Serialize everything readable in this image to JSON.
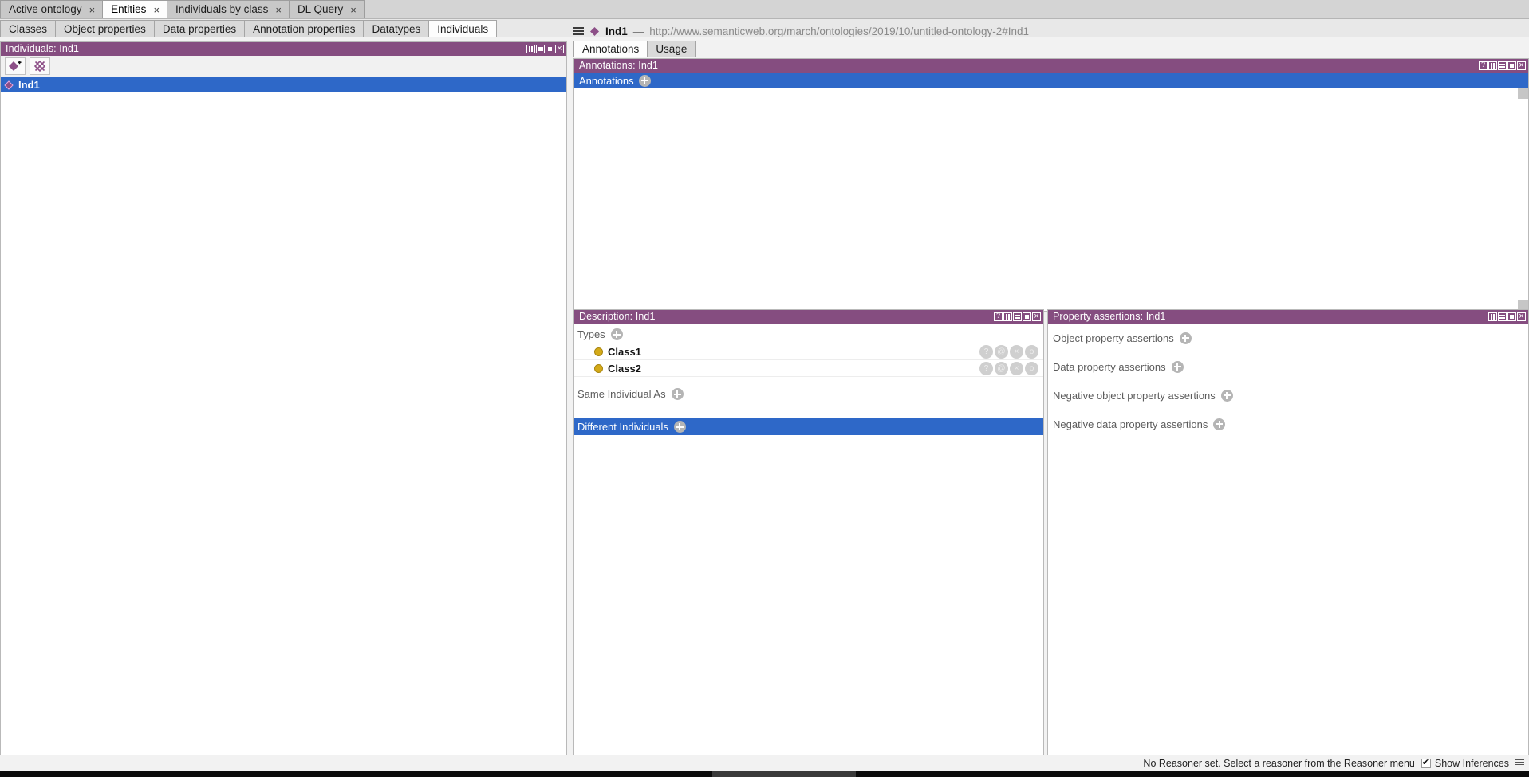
{
  "window": {
    "top_tabs": [
      {
        "label": "Active ontology",
        "active": false,
        "closable": true
      },
      {
        "label": "Entities",
        "active": true,
        "closable": true
      },
      {
        "label": "Individuals by class",
        "active": false,
        "closable": true
      },
      {
        "label": "DL Query",
        "active": false,
        "closable": true
      }
    ],
    "entity_tabs": [
      {
        "label": "Classes",
        "active": false
      },
      {
        "label": "Object properties",
        "active": false
      },
      {
        "label": "Data properties",
        "active": false
      },
      {
        "label": "Annotation properties",
        "active": false
      },
      {
        "label": "Datatypes",
        "active": false
      },
      {
        "label": "Individuals",
        "active": true
      }
    ]
  },
  "colors": {
    "panel_header": "#854d80",
    "selection_blue": "#2e68c8",
    "class_dot": "#d4aa18",
    "individual_diamond": "#8c4f87"
  },
  "individuals_panel": {
    "title": "Individuals: Ind1",
    "toolbar": [
      {
        "name": "add-individual-button",
        "icon": "diamond-plus-icon"
      },
      {
        "name": "delete-individual-button",
        "icon": "diamond-crossed-icon"
      }
    ],
    "items": [
      {
        "label": "Ind1",
        "icon": "individual-diamond-icon",
        "selected": true
      }
    ],
    "controls": [
      "split",
      "collapse",
      "maximize",
      "close"
    ]
  },
  "iri_bar": {
    "menu_icon": "hamburger-icon",
    "entity_icon": "individual-diamond-icon",
    "name": "Ind1",
    "separator": "—",
    "iri": "http://www.semanticweb.org/march/ontologies/2019/10/untitled-ontology-2#Ind1"
  },
  "annotation_tabs": [
    {
      "label": "Annotations",
      "active": true
    },
    {
      "label": "Usage",
      "active": false
    }
  ],
  "annotations_panel": {
    "title": "Annotations: Ind1",
    "section_label": "Annotations",
    "add_button": "add-annotation-button",
    "selected": true,
    "controls": [
      "help",
      "split",
      "collapse",
      "maximize",
      "close"
    ]
  },
  "description_panel": {
    "title": "Description: Ind1",
    "controls": [
      "help",
      "split",
      "collapse",
      "maximize",
      "close"
    ],
    "sections": [
      {
        "label": "Types",
        "add_button": "add-type-button",
        "selected": false,
        "rows": [
          {
            "label": "Class1",
            "icon": "class-circle-icon",
            "actions": [
              "?",
              "@",
              "×",
              "o"
            ]
          },
          {
            "label": "Class2",
            "icon": "class-circle-icon",
            "actions": [
              "?",
              "@",
              "×",
              "o"
            ]
          }
        ]
      },
      {
        "label": "Same Individual As",
        "add_button": "add-same-individual-button",
        "selected": false,
        "rows": []
      },
      {
        "label": "Different Individuals",
        "add_button": "add-different-individuals-button",
        "selected": true,
        "rows": []
      }
    ]
  },
  "property_assertions_panel": {
    "title": "Property assertions: Ind1",
    "controls": [
      "split",
      "collapse",
      "maximize",
      "close"
    ],
    "sections": [
      {
        "label": "Object property assertions",
        "add_button": "add-object-property-assertion-button"
      },
      {
        "label": "Data property assertions",
        "add_button": "add-data-property-assertion-button"
      },
      {
        "label": "Negative object property assertions",
        "add_button": "add-negative-object-property-assertion-button"
      },
      {
        "label": "Negative data property assertions",
        "add_button": "add-negative-data-property-assertion-button"
      }
    ]
  },
  "status_bar": {
    "reasoner_message": "No Reasoner set. Select a reasoner from the Reasoner menu",
    "show_inferences_label": "Show Inferences",
    "show_inferences_checked": true,
    "log_icon": "log-lines-icon"
  }
}
